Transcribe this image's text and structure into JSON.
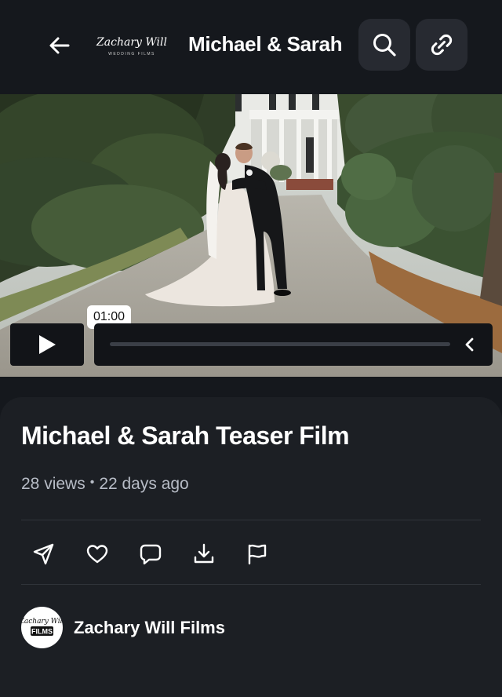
{
  "header": {
    "title": "Michael & Sarah",
    "logo_text": "Zachary Will",
    "logo_subtext": "WEDDING FILMS",
    "back_icon": "arrow-left-icon",
    "search_icon": "search-icon",
    "link_icon": "link-icon"
  },
  "player": {
    "time_tooltip": "01:00",
    "progress": 0,
    "play_icon": "play-icon",
    "collapse_icon": "chevron-left-icon"
  },
  "video_info": {
    "title": "Michael & Sarah Teaser Film",
    "views": "28 views",
    "separator": "•",
    "age": "22 days ago"
  },
  "actions": [
    {
      "name": "share",
      "icon": "send-icon"
    },
    {
      "name": "like",
      "icon": "heart-icon"
    },
    {
      "name": "comment",
      "icon": "comment-icon"
    },
    {
      "name": "download",
      "icon": "download-icon"
    },
    {
      "name": "report",
      "icon": "flag-icon"
    }
  ],
  "channel": {
    "name": "Zachary Will Films",
    "avatar_text_top": "Zachary Will",
    "avatar_text_bottom": "FILMS"
  },
  "colors": {
    "background": "#15181d",
    "card": "#1c1f24",
    "button": "#272a31",
    "muted_text": "#b7bcc6"
  }
}
